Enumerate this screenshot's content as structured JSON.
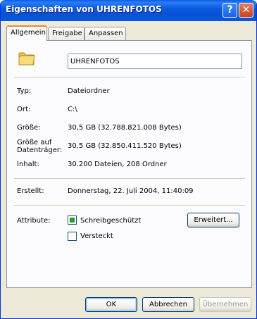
{
  "window": {
    "title": "Eigenschaften von UHRENFOTOS",
    "help_glyph": "?",
    "close_glyph": "✕"
  },
  "tabs": [
    {
      "label": "Allgemein",
      "active": true
    },
    {
      "label": "Freigabe",
      "active": false
    },
    {
      "label": "Anpassen",
      "active": false
    }
  ],
  "general": {
    "name_value": "UHRENFOTOS",
    "icon": "folder-icon",
    "rows": {
      "type": {
        "label": "Typ:",
        "value": "Dateiordner"
      },
      "location": {
        "label": "Ort:",
        "value": "C:\\"
      },
      "size": {
        "label": "Größe:",
        "value": "30,5 GB (32.788.821.008 Bytes)"
      },
      "size_on_disk": {
        "label_line1": "Größe auf",
        "label_line2": "Datenträger:",
        "value": "30,5 GB (32.850.411.520 Bytes)"
      },
      "contents": {
        "label": "Inhalt:",
        "value": "30.200 Dateien, 208 Ordner"
      },
      "created": {
        "label": "Erstellt:",
        "value": "Donnerstag, 22. Juli 2004, 11:40:09"
      }
    },
    "attributes": {
      "label": "Attribute:",
      "read_only": {
        "label": "Schreibgeschützt",
        "checked": true
      },
      "hidden": {
        "label": "Versteckt",
        "checked": false
      },
      "advanced_button": "Erweitert..."
    }
  },
  "buttons": {
    "ok": "OK",
    "cancel": "Abbrechen",
    "apply": "Übernehmen"
  },
  "colors": {
    "titlebar": "#0a5be0",
    "dialog_bg": "#ece9d8",
    "panel_bg": "#fcfcfe",
    "tab_highlight": "#e68b2c",
    "checkbox_fill": "#21a121"
  }
}
